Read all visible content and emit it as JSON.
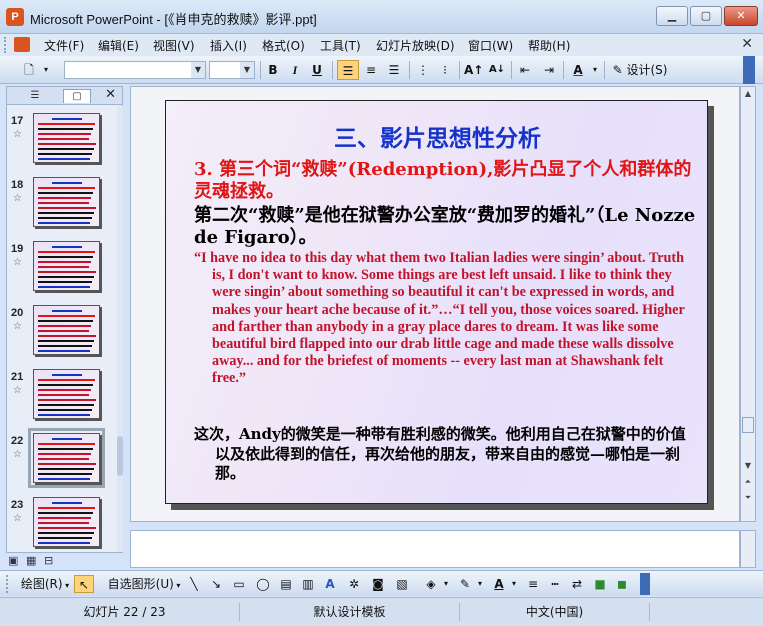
{
  "window": {
    "title": "Microsoft PowerPoint - [《肖申克的救赎》影评.ppt]",
    "app_icon_letter": "P"
  },
  "menu": [
    "文件(F)",
    "编辑(E)",
    "视图(V)",
    "插入(I)",
    "格式(O)",
    "工具(T)",
    "幻灯片放映(D)",
    "窗口(W)",
    "帮助(H)"
  ],
  "toolbar": {
    "font_name": "",
    "font_size": "",
    "bold": "B",
    "italic": "I",
    "underline": "U",
    "design_label": "设计(S)"
  },
  "slides_pane": {
    "tabs": [
      "outline",
      "slides"
    ],
    "thumbnails": [
      {
        "num": "17",
        "selected": false
      },
      {
        "num": "18",
        "selected": false
      },
      {
        "num": "19",
        "selected": false
      },
      {
        "num": "20",
        "selected": false
      },
      {
        "num": "21",
        "selected": false
      },
      {
        "num": "22",
        "selected": true
      },
      {
        "num": "23",
        "selected": false
      }
    ],
    "star_glyph": "☆"
  },
  "slide": {
    "title": "三、影片思想性分析",
    "point": "3. 第三个词“救赎”(Redemption),影片凸显了个人和群体的灵魂拯救。",
    "note": "第二次“救赎”是他在狱警办公室放“费加罗的婚礼”（Le Nozze de Figaro）。",
    "quote": "“I have no idea to this day what them two Italian ladies were singin’ about. Truth is, I don't want to know. Some things are best left unsaid. I like to think they were singin’ about something so beautiful it can't be expressed in words, and makes your heart ache because of it.”…“I tell you, those voices soared. Higher and farther than anybody in a gray place dares to dream. It was like some beautiful bird flapped into our drab little cage and made these walls dissolve away... and for the briefest of moments -- every last man at Shawshank felt free.”",
    "conclusion": "这次，Andy的微笑是一种带有胜利感的微笑。他利用自己在狱警中的价值以及依此得到的信任，再次给他的朋友，带来自由的感觉—哪怕是一刹那。"
  },
  "drawing": {
    "draw_label": "绘图(R)",
    "autoshapes_label": "自选图形(U)"
  },
  "status": {
    "slide_info": "幻灯片 22 / 23",
    "template": "默认设计模板",
    "language": "中文(中国)"
  },
  "colors": {
    "title_blue": "#1533c8",
    "point_red": "#e01515",
    "quote_red": "#c0142c"
  }
}
